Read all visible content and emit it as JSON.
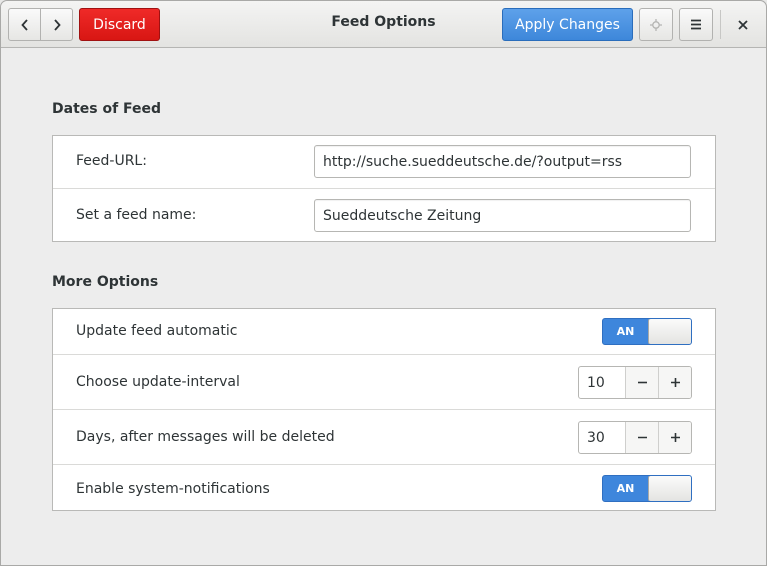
{
  "header": {
    "title": "Feed Options",
    "discard_label": "Discard",
    "apply_label": "Apply Changes"
  },
  "sections": {
    "dates": {
      "title": "Dates of Feed",
      "url_label": "Feed-URL:",
      "url_value": "http://suche.sueddeutsche.de/?output=rss",
      "name_label": "Set a feed name:",
      "name_value": "Sueddeutsche Zeitung"
    },
    "more": {
      "title": "More Options",
      "auto_update_label": "Update feed automatic",
      "auto_update_state": "AN",
      "interval_label": "Choose update-interval",
      "interval_value": "10",
      "delete_label": "Days, after messages will be deleted",
      "delete_value": "30",
      "notify_label": "Enable system-notifications",
      "notify_state": "AN"
    }
  },
  "icons": {
    "back": "chevron-left-icon",
    "forward": "chevron-right-icon",
    "crosshair": "crosshair-icon",
    "menu": "hamburger-menu-icon",
    "close": "close-icon"
  },
  "colors": {
    "discard": "#e0201d",
    "accent": "#4a90d9"
  }
}
